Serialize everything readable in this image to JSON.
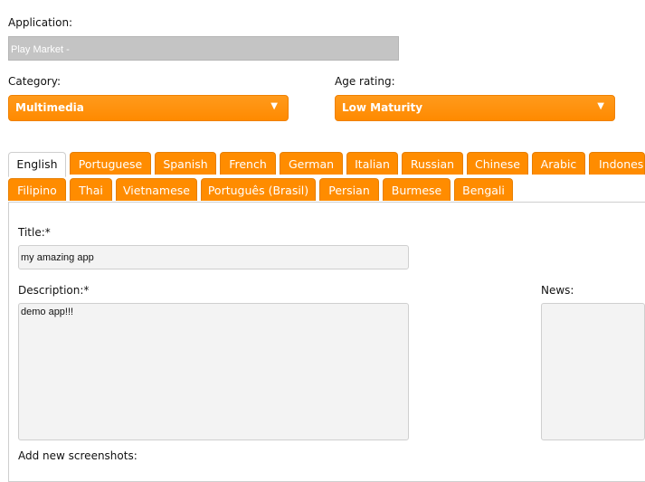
{
  "application": {
    "label": "Application:",
    "value": "Play Market -"
  },
  "category": {
    "label": "Category:",
    "selected": "Multimedia"
  },
  "age_rating": {
    "label": "Age rating:",
    "selected": "Low Maturity"
  },
  "language_tabs": {
    "row1": [
      "English",
      "Portuguese",
      "Spanish",
      "French",
      "German",
      "Italian",
      "Russian",
      "Chinese",
      "Arabic",
      "Indonesi"
    ],
    "row2": [
      "Filipino",
      "Thai",
      "Vietnamese",
      "Português (Brasil)",
      "Persian",
      "Burmese",
      "Bengali"
    ],
    "active": "English"
  },
  "form": {
    "title_label": "Title:*",
    "title_value": "my amazing app",
    "description_label": "Description:*",
    "description_value": "demo app!!!",
    "news_label": "News:",
    "screenshots_label": "Add new screenshots:"
  },
  "colors": {
    "accent": "#ff8c00",
    "disabled_field": "#c4c4c4",
    "input_bg": "#f3f3f3"
  },
  "icons": {
    "dropdown": "triangle-down-icon"
  }
}
